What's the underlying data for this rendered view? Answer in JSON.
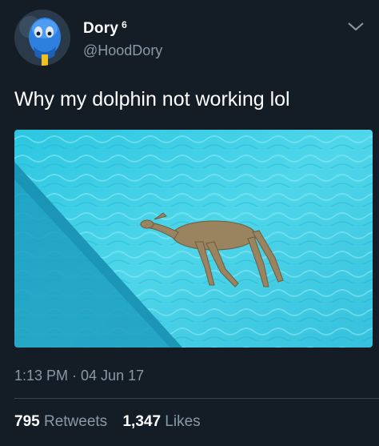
{
  "user": {
    "display_name": "Dory",
    "badge": "6",
    "handle": "@HoodDory"
  },
  "tweet": {
    "text": "Why my dolphin not working lol",
    "timestamp": "1:13 PM · 04 Jun 17"
  },
  "stats": {
    "retweets_count": "795",
    "retweets_label": "Retweets",
    "likes_count": "1,347",
    "likes_label": "Likes"
  },
  "colors": {
    "background": "#141d26",
    "secondary_text": "#8899a6",
    "divider": "#38444d"
  },
  "icons": {
    "menu": "chevron-down-icon"
  }
}
